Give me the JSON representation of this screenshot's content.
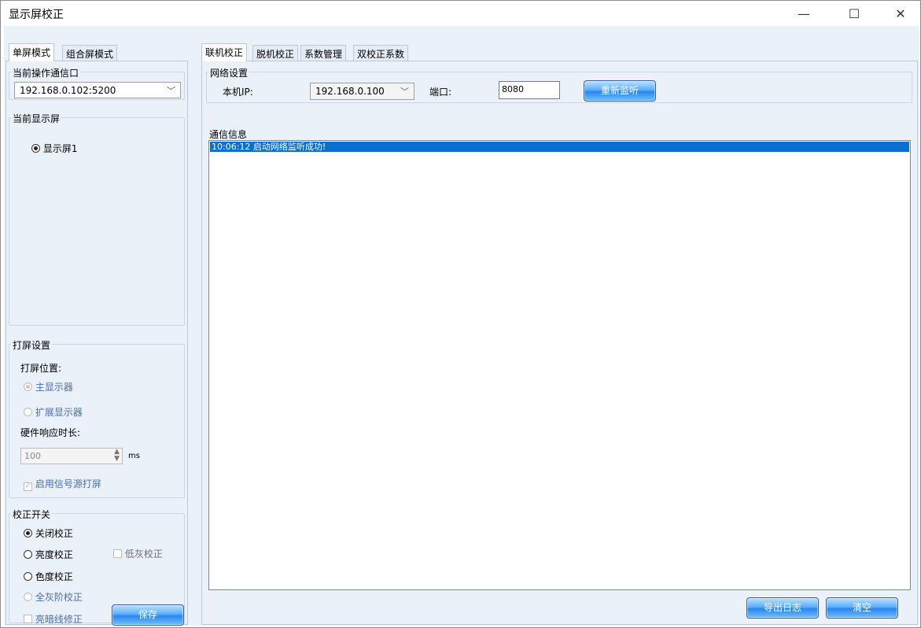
{
  "window": {
    "title": "显示屏校正",
    "controls": {
      "minimize": "—",
      "maximize": "☐",
      "close": "✕"
    }
  },
  "left": {
    "tabs": [
      "单屏模式",
      "组合屏模式"
    ],
    "current_port": {
      "label": "当前操作通信口",
      "value": "192.168.0.102:5200"
    },
    "current_display": {
      "label": "当前显示屏",
      "items": [
        "显示屏1"
      ]
    },
    "screen_settings": {
      "label": "打屏设置",
      "position_label": "打屏位置:",
      "options": [
        "主显示器",
        "扩展显示器"
      ],
      "hw_response_label": "硬件响应时长:",
      "hw_response_value": "100",
      "hw_response_unit": "ms",
      "signal_source_label": "启用信号源打屏"
    },
    "calibration_switch": {
      "label": "校正开关",
      "options": [
        "关闭校正",
        "亮度校正",
        "色度校正",
        "全灰阶校正"
      ],
      "low_gray_label": "低灰校正",
      "dark_line_label": "亮暗线修正",
      "save_label": "保存"
    }
  },
  "right": {
    "tabs": [
      "联机校正",
      "脱机校正",
      "系数管理",
      "双校正系数"
    ],
    "network": {
      "label": "网络设置",
      "ip_label": "本机IP:",
      "ip_value": "192.168.0.100",
      "port_label": "端口:",
      "port_value": "8080",
      "relisten_label": "重新监听"
    },
    "comm": {
      "label": "通信信息",
      "log_lines": [
        "10:06:12  启动网络监听成功!"
      ]
    },
    "export_label": "导出日志",
    "clear_label": "清空"
  }
}
